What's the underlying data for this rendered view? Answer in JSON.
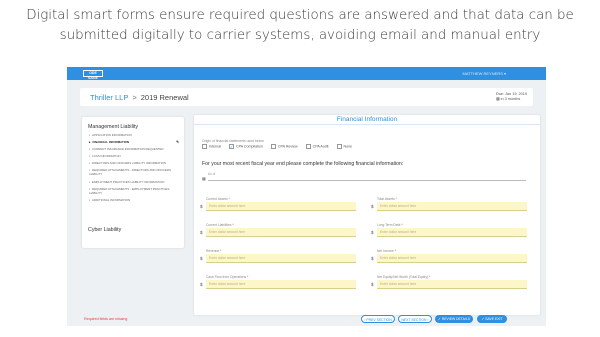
{
  "headline": {
    "line1": "Digital smart forms ensure required questions are answered and that data can be",
    "line2": "submitted digitally to carrier systems, avoiding email and manual entry"
  },
  "app": {
    "logo": "ODE SAGE",
    "user_menu": "MATTHEW REYNERS ▾",
    "account_name": "Thriller LLP",
    "separator": ">",
    "renewal": "2019 Renewal",
    "due_date": "Due: Jan 19, 2019",
    "due_days": "in 3 months"
  },
  "sidebar": {
    "section1": "Management Liability",
    "items": [
      {
        "label": "APPLICATION INFORMATION",
        "active": false
      },
      {
        "label": "FINANCIAL INFORMATION",
        "active": true
      },
      {
        "label": "CURRENT INSURANCE INFORMATION REQUESTED",
        "active": false
      },
      {
        "label": "LOSS INFORMATION",
        "active": false
      },
      {
        "label": "DIRECTORS AND OFFICERS LIABILITY INFORMATION",
        "active": false
      },
      {
        "label": "REQUIRED ATTACHMENTS - DIRECTORS AND OFFICERS LIABILITY",
        "active": false
      },
      {
        "label": "EMPLOYMENT PRACTICES LIABILITY INFORMATION",
        "active": false
      },
      {
        "label": "REQUIRED ATTACHMENTS - EMPLOYMENT PRACTICES LIABILITY",
        "active": false
      },
      {
        "label": "ADDITIONAL INFORMATION",
        "active": false
      }
    ],
    "section2": "Cyber Liability"
  },
  "main": {
    "title": "Financial Information",
    "question": "Origin of financial statements used below",
    "options": [
      {
        "label": "Internal",
        "checked": false
      },
      {
        "label": "CPA Compilation",
        "checked": true
      },
      {
        "label": "CPA Review",
        "checked": false
      },
      {
        "label": "CPA Audit",
        "checked": false
      },
      {
        "label": "None",
        "checked": false
      }
    ],
    "instruction": "For your most recent fiscal year end please complete the following financial information:",
    "as_of_label": "As of",
    "fields": [
      {
        "label": "Current Assets",
        "placeholder": "Enter dollar amount here"
      },
      {
        "label": "Total Assets",
        "placeholder": "Enter dollar amount here"
      },
      {
        "label": "Current Liabilities",
        "placeholder": "Enter dollar amount here"
      },
      {
        "label": "Long Term Debt",
        "placeholder": "Enter dollar amount here"
      },
      {
        "label": "Revenue",
        "placeholder": "Enter dollar amount here"
      },
      {
        "label": "Net Income",
        "placeholder": "Enter dollar amount here"
      },
      {
        "label": "Cash Flow from Operations",
        "placeholder": "Enter dollar amount here"
      },
      {
        "label": "Net Equity/Net Worth (Total Equity)",
        "placeholder": "Enter dollar amount here"
      }
    ],
    "currency": "$",
    "required_mark": "*"
  },
  "footer": {
    "required_note": "Required fields are missing",
    "prev": "‹ PREV SECTION",
    "next": "NEXT SECTION ›",
    "review": "✓ REVIEW DETAILS",
    "save": "✓ SAVE EXIT"
  },
  "colors": {
    "accent": "#2f8fe0",
    "required": "#e53935",
    "field_fill": "#fdf6c8"
  }
}
